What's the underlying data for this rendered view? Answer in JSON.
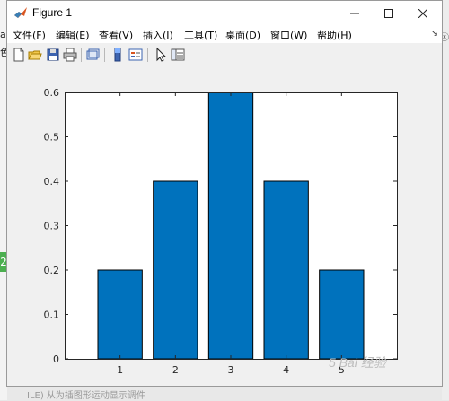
{
  "window": {
    "title": "Figure 1"
  },
  "menu": [
    {
      "label": "文件(F)"
    },
    {
      "label": "编辑(E)"
    },
    {
      "label": "查看(V)"
    },
    {
      "label": "插入(I)"
    },
    {
      "label": "工具(T)"
    },
    {
      "label": "桌面(D)"
    },
    {
      "label": "窗口(W)"
    },
    {
      "label": "帮助(H)"
    }
  ],
  "toolbar": {
    "icons": [
      "new-figure-icon",
      "open-file-icon",
      "save-icon",
      "print-icon",
      "link-plot-icon",
      "insert-colorbar-icon",
      "insert-legend-icon",
      "edit-plot-icon",
      "property-inspector-icon"
    ]
  },
  "background": {
    "edge_text_1": "a",
    "edge_text_2": "色",
    "green_tab": "2",
    "right_text": "ⓧ",
    "caption": "ILE) 从为插图形运动显示调件",
    "watermark": "5 Bai 经验"
  },
  "colors": {
    "bar_fill": "#0072bd",
    "axes_bg": "#ffffff",
    "figure_bg": "#f0f0f0"
  },
  "chart_data": {
    "type": "bar",
    "categories": [
      "1",
      "2",
      "3",
      "4",
      "5"
    ],
    "values": [
      0.2,
      0.4,
      0.6,
      0.4,
      0.2
    ],
    "xlim": [
      0,
      6
    ],
    "ylim": [
      0,
      0.6
    ],
    "yticks": [
      "0",
      "0.1",
      "0.2",
      "0.3",
      "0.4",
      "0.5",
      "0.6"
    ],
    "title": "",
    "xlabel": "",
    "ylabel": "",
    "grid": false,
    "legend": "none"
  }
}
